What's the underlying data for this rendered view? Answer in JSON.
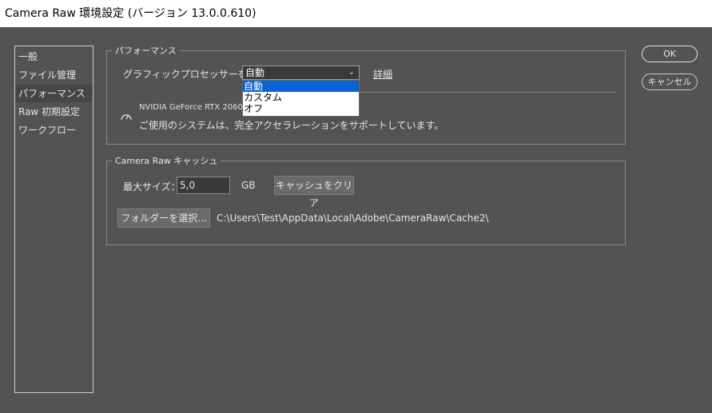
{
  "window": {
    "title": "Camera Raw 環境設定 (バージョン 13.0.0.610)"
  },
  "sidebar": {
    "items": [
      "一般",
      "ファイル管理",
      "パフォーマンス",
      "Raw 初期設定",
      "ワークフロー"
    ],
    "selected_index": 2
  },
  "performance": {
    "legend": "パフォーマンス",
    "gpu_label": "グラフィックプロセッサーを使用：",
    "gpu_select_value": "自動",
    "gpu_options": [
      "自動",
      "カスタム",
      "オフ"
    ],
    "detail_link": "詳細",
    "gpu_name": "NVIDIA GeForce RTX 2060",
    "gpu_status": "ご使用のシステムは、完全アクセラレーションをサポートしています。"
  },
  "cache": {
    "legend": "Camera Raw キャッシュ",
    "max_size_label": "最大サイズ：",
    "max_size_value": "5,0",
    "unit": "GB",
    "clear_button": "キャッシュをクリア",
    "folder_button": "フォルダーを選択...",
    "path": "C:\\Users\\Test\\AppData\\Local\\Adobe\\CameraRaw\\Cache2\\"
  },
  "actions": {
    "ok": "OK",
    "cancel": "キャンセル"
  }
}
